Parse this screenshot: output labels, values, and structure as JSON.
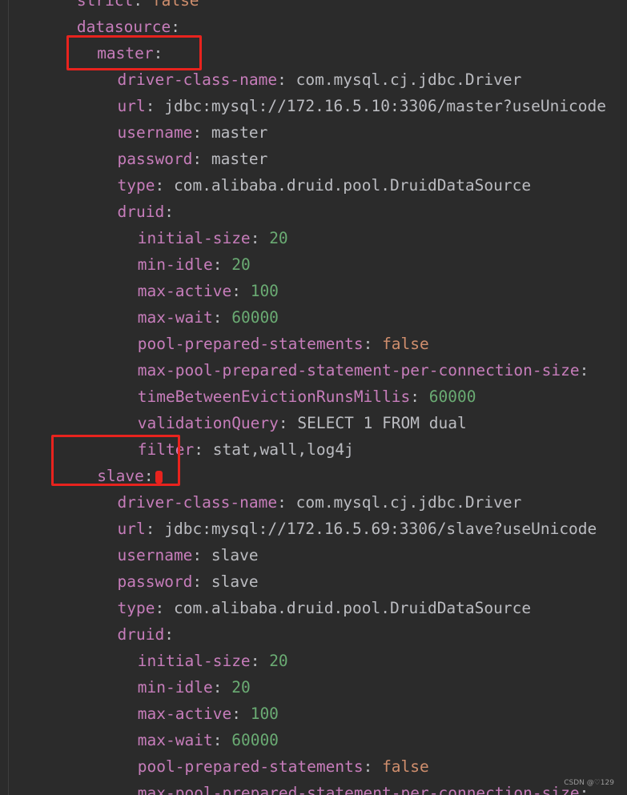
{
  "editor": {
    "lines": [
      {
        "indent": 3,
        "key": "strict",
        "value": "false",
        "vtype": "bool"
      },
      {
        "indent": 3,
        "key": "datasource",
        "value": "",
        "vtype": "none"
      },
      {
        "indent": 4,
        "key": "master",
        "value": "",
        "vtype": "none"
      },
      {
        "indent": 5,
        "key": "driver-class-name",
        "value": "com.mysql.cj.jdbc.Driver",
        "vtype": "str"
      },
      {
        "indent": 5,
        "key": "url",
        "value": "jdbc:mysql://172.16.5.10:3306/master?useUnicode",
        "vtype": "str"
      },
      {
        "indent": 5,
        "key": "username",
        "value": "master",
        "vtype": "str"
      },
      {
        "indent": 5,
        "key": "password",
        "value": "master",
        "vtype": "str"
      },
      {
        "indent": 5,
        "key": "type",
        "value": "com.alibaba.druid.pool.DruidDataSource",
        "vtype": "str"
      },
      {
        "indent": 5,
        "key": "druid",
        "value": "",
        "vtype": "none"
      },
      {
        "indent": 6,
        "key": "initial-size",
        "value": "20",
        "vtype": "num"
      },
      {
        "indent": 6,
        "key": "min-idle",
        "value": "20",
        "vtype": "num"
      },
      {
        "indent": 6,
        "key": "max-active",
        "value": "100",
        "vtype": "num"
      },
      {
        "indent": 6,
        "key": "max-wait",
        "value": "60000",
        "vtype": "num"
      },
      {
        "indent": 6,
        "key": "pool-prepared-statements",
        "value": "false",
        "vtype": "bool"
      },
      {
        "indent": 6,
        "key": "max-pool-prepared-statement-per-connection-size",
        "value": "",
        "vtype": "none"
      },
      {
        "indent": 6,
        "key": "timeBetweenEvictionRunsMillis",
        "value": "60000",
        "vtype": "num"
      },
      {
        "indent": 6,
        "key": "validationQuery",
        "value": "SELECT 1 FROM dual",
        "vtype": "str"
      },
      {
        "indent": 6,
        "key": "filter",
        "value": "stat,wall,log4j",
        "vtype": "str"
      },
      {
        "indent": 4,
        "key": "slave",
        "value": "",
        "vtype": "none",
        "caret": true
      },
      {
        "indent": 5,
        "key": "driver-class-name",
        "value": "com.mysql.cj.jdbc.Driver",
        "vtype": "str"
      },
      {
        "indent": 5,
        "key": "url",
        "value": "jdbc:mysql://172.16.5.69:3306/slave?useUnicode",
        "vtype": "str"
      },
      {
        "indent": 5,
        "key": "username",
        "value": "slave",
        "vtype": "str"
      },
      {
        "indent": 5,
        "key": "password",
        "value": "slave",
        "vtype": "str"
      },
      {
        "indent": 5,
        "key": "type",
        "value": "com.alibaba.druid.pool.DruidDataSource",
        "vtype": "str"
      },
      {
        "indent": 5,
        "key": "druid",
        "value": "",
        "vtype": "none"
      },
      {
        "indent": 6,
        "key": "initial-size",
        "value": "20",
        "vtype": "num"
      },
      {
        "indent": 6,
        "key": "min-idle",
        "value": "20",
        "vtype": "num"
      },
      {
        "indent": 6,
        "key": "max-active",
        "value": "100",
        "vtype": "num"
      },
      {
        "indent": 6,
        "key": "max-wait",
        "value": "60000",
        "vtype": "num"
      },
      {
        "indent": 6,
        "key": "pool-prepared-statements",
        "value": "false",
        "vtype": "bool"
      },
      {
        "indent": 6,
        "key": "max-pool-prepared-statement-per-connection-size",
        "value": "",
        "vtype": "none"
      }
    ]
  },
  "watermark": "CSDN @♡129",
  "colors": {
    "background": "#2b2b2b",
    "key": "#c77dbb",
    "string": "#bbbcc1",
    "number": "#6aab73",
    "boolean": "#cf8e6d",
    "highlight": "#e8231e"
  }
}
